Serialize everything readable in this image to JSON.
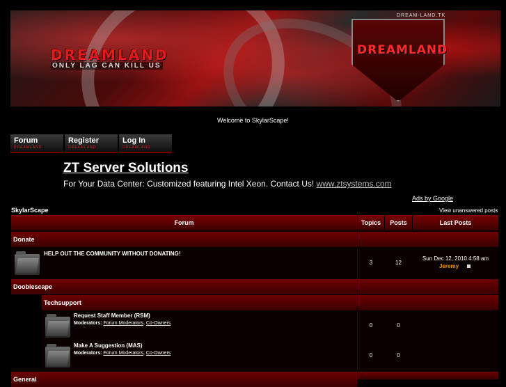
{
  "banner": {
    "title": "DREAMLAND",
    "slogan": "ONLY LAG CAN KILL US",
    "url": "DREAM-LAND.TK",
    "shield_text": "DREAMLAND"
  },
  "welcome": "Welcome to SkylarScape!",
  "nav": [
    {
      "label": "Forum",
      "sub": "DREAMLAND"
    },
    {
      "label": "Register",
      "sub": "DREAMLAND"
    },
    {
      "label": "Log In",
      "sub": "DREAMLAND"
    }
  ],
  "ad": {
    "title": "ZT Server Solutions",
    "text": "For Your Data Center: Customized featuring Intel Xeon. Contact Us!",
    "link": "www.ztsystems.com",
    "ads_by": "Ads by Google"
  },
  "crumb": "SkylarScape",
  "view_unanswered": "View unanswered posts",
  "table": {
    "headers": {
      "forum": "Forum",
      "topics": "Topics",
      "posts": "Posts",
      "last_post": "Last Posts"
    },
    "categories": [
      {
        "name": "Donate"
      },
      {
        "name": "Doobiescape"
      },
      {
        "name": "General"
      }
    ],
    "donate_forum": {
      "title": "HELP OUT THE COMMUNITY WITHOUT DONATING!",
      "topics": "3",
      "posts": "12",
      "last_date": "Sun Dec 12, 2010 4:58 am",
      "last_user": "Jeremy"
    },
    "subcategory": "Techsupport",
    "sub_forums": [
      {
        "title": "Request Staff Member (RSM)",
        "mods_label": "Moderators:",
        "mod1": "Forum Moderators",
        "mod2": "Co-Owners",
        "topics": "0",
        "posts": "0"
      },
      {
        "title": "Make A Suggestion (MAS)",
        "mods_label": "Moderators:",
        "mod1": "Forum Moderators",
        "mod2": "Co-Owners",
        "topics": "0",
        "posts": "0"
      }
    ]
  }
}
